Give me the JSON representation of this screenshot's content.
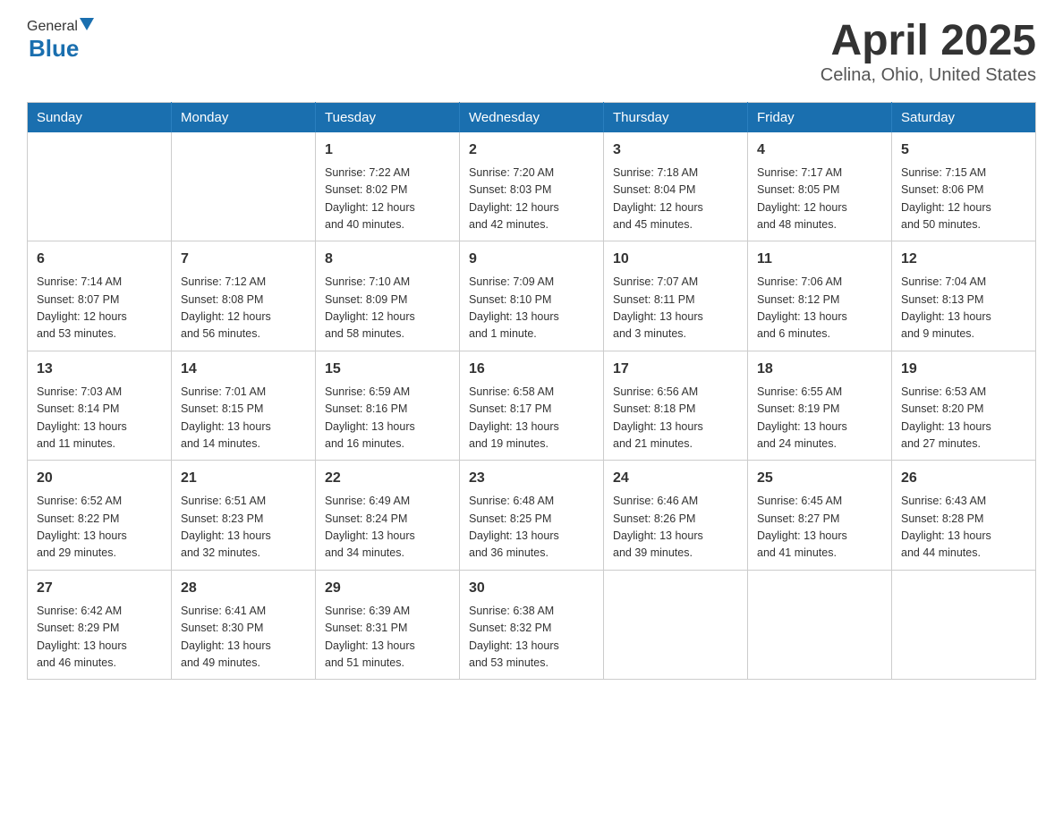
{
  "header": {
    "logo_general": "General",
    "logo_blue": "Blue",
    "title": "April 2025",
    "subtitle": "Celina, Ohio, United States"
  },
  "days_of_week": [
    "Sunday",
    "Monday",
    "Tuesday",
    "Wednesday",
    "Thursday",
    "Friday",
    "Saturday"
  ],
  "weeks": [
    [
      {
        "day": "",
        "info": ""
      },
      {
        "day": "",
        "info": ""
      },
      {
        "day": "1",
        "info": "Sunrise: 7:22 AM\nSunset: 8:02 PM\nDaylight: 12 hours\nand 40 minutes."
      },
      {
        "day": "2",
        "info": "Sunrise: 7:20 AM\nSunset: 8:03 PM\nDaylight: 12 hours\nand 42 minutes."
      },
      {
        "day": "3",
        "info": "Sunrise: 7:18 AM\nSunset: 8:04 PM\nDaylight: 12 hours\nand 45 minutes."
      },
      {
        "day": "4",
        "info": "Sunrise: 7:17 AM\nSunset: 8:05 PM\nDaylight: 12 hours\nand 48 minutes."
      },
      {
        "day": "5",
        "info": "Sunrise: 7:15 AM\nSunset: 8:06 PM\nDaylight: 12 hours\nand 50 minutes."
      }
    ],
    [
      {
        "day": "6",
        "info": "Sunrise: 7:14 AM\nSunset: 8:07 PM\nDaylight: 12 hours\nand 53 minutes."
      },
      {
        "day": "7",
        "info": "Sunrise: 7:12 AM\nSunset: 8:08 PM\nDaylight: 12 hours\nand 56 minutes."
      },
      {
        "day": "8",
        "info": "Sunrise: 7:10 AM\nSunset: 8:09 PM\nDaylight: 12 hours\nand 58 minutes."
      },
      {
        "day": "9",
        "info": "Sunrise: 7:09 AM\nSunset: 8:10 PM\nDaylight: 13 hours\nand 1 minute."
      },
      {
        "day": "10",
        "info": "Sunrise: 7:07 AM\nSunset: 8:11 PM\nDaylight: 13 hours\nand 3 minutes."
      },
      {
        "day": "11",
        "info": "Sunrise: 7:06 AM\nSunset: 8:12 PM\nDaylight: 13 hours\nand 6 minutes."
      },
      {
        "day": "12",
        "info": "Sunrise: 7:04 AM\nSunset: 8:13 PM\nDaylight: 13 hours\nand 9 minutes."
      }
    ],
    [
      {
        "day": "13",
        "info": "Sunrise: 7:03 AM\nSunset: 8:14 PM\nDaylight: 13 hours\nand 11 minutes."
      },
      {
        "day": "14",
        "info": "Sunrise: 7:01 AM\nSunset: 8:15 PM\nDaylight: 13 hours\nand 14 minutes."
      },
      {
        "day": "15",
        "info": "Sunrise: 6:59 AM\nSunset: 8:16 PM\nDaylight: 13 hours\nand 16 minutes."
      },
      {
        "day": "16",
        "info": "Sunrise: 6:58 AM\nSunset: 8:17 PM\nDaylight: 13 hours\nand 19 minutes."
      },
      {
        "day": "17",
        "info": "Sunrise: 6:56 AM\nSunset: 8:18 PM\nDaylight: 13 hours\nand 21 minutes."
      },
      {
        "day": "18",
        "info": "Sunrise: 6:55 AM\nSunset: 8:19 PM\nDaylight: 13 hours\nand 24 minutes."
      },
      {
        "day": "19",
        "info": "Sunrise: 6:53 AM\nSunset: 8:20 PM\nDaylight: 13 hours\nand 27 minutes."
      }
    ],
    [
      {
        "day": "20",
        "info": "Sunrise: 6:52 AM\nSunset: 8:22 PM\nDaylight: 13 hours\nand 29 minutes."
      },
      {
        "day": "21",
        "info": "Sunrise: 6:51 AM\nSunset: 8:23 PM\nDaylight: 13 hours\nand 32 minutes."
      },
      {
        "day": "22",
        "info": "Sunrise: 6:49 AM\nSunset: 8:24 PM\nDaylight: 13 hours\nand 34 minutes."
      },
      {
        "day": "23",
        "info": "Sunrise: 6:48 AM\nSunset: 8:25 PM\nDaylight: 13 hours\nand 36 minutes."
      },
      {
        "day": "24",
        "info": "Sunrise: 6:46 AM\nSunset: 8:26 PM\nDaylight: 13 hours\nand 39 minutes."
      },
      {
        "day": "25",
        "info": "Sunrise: 6:45 AM\nSunset: 8:27 PM\nDaylight: 13 hours\nand 41 minutes."
      },
      {
        "day": "26",
        "info": "Sunrise: 6:43 AM\nSunset: 8:28 PM\nDaylight: 13 hours\nand 44 minutes."
      }
    ],
    [
      {
        "day": "27",
        "info": "Sunrise: 6:42 AM\nSunset: 8:29 PM\nDaylight: 13 hours\nand 46 minutes."
      },
      {
        "day": "28",
        "info": "Sunrise: 6:41 AM\nSunset: 8:30 PM\nDaylight: 13 hours\nand 49 minutes."
      },
      {
        "day": "29",
        "info": "Sunrise: 6:39 AM\nSunset: 8:31 PM\nDaylight: 13 hours\nand 51 minutes."
      },
      {
        "day": "30",
        "info": "Sunrise: 6:38 AM\nSunset: 8:32 PM\nDaylight: 13 hours\nand 53 minutes."
      },
      {
        "day": "",
        "info": ""
      },
      {
        "day": "",
        "info": ""
      },
      {
        "day": "",
        "info": ""
      }
    ]
  ]
}
